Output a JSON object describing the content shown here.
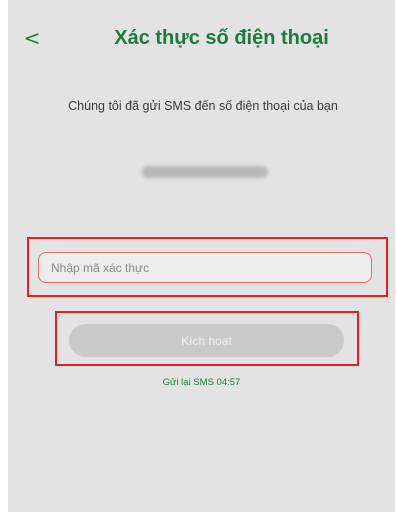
{
  "header": {
    "back_label": "<",
    "title": "Xác thực số điện thoại"
  },
  "message": {
    "text": "Chúng tôi đã gửi SMS đến số điện thoại của bạn"
  },
  "phone": {
    "masked_value": ""
  },
  "code_input": {
    "placeholder": "Nhập mã xác thực",
    "value": ""
  },
  "activate_button": {
    "label": "Kích hoạt"
  },
  "resend": {
    "text": "Gửi lại SMS 04:57"
  },
  "colors": {
    "accent": "#1f7a3f",
    "background": "#e3e3e3",
    "highlight_border": "#e31e25",
    "button_disabled": "#c9c9c9"
  }
}
